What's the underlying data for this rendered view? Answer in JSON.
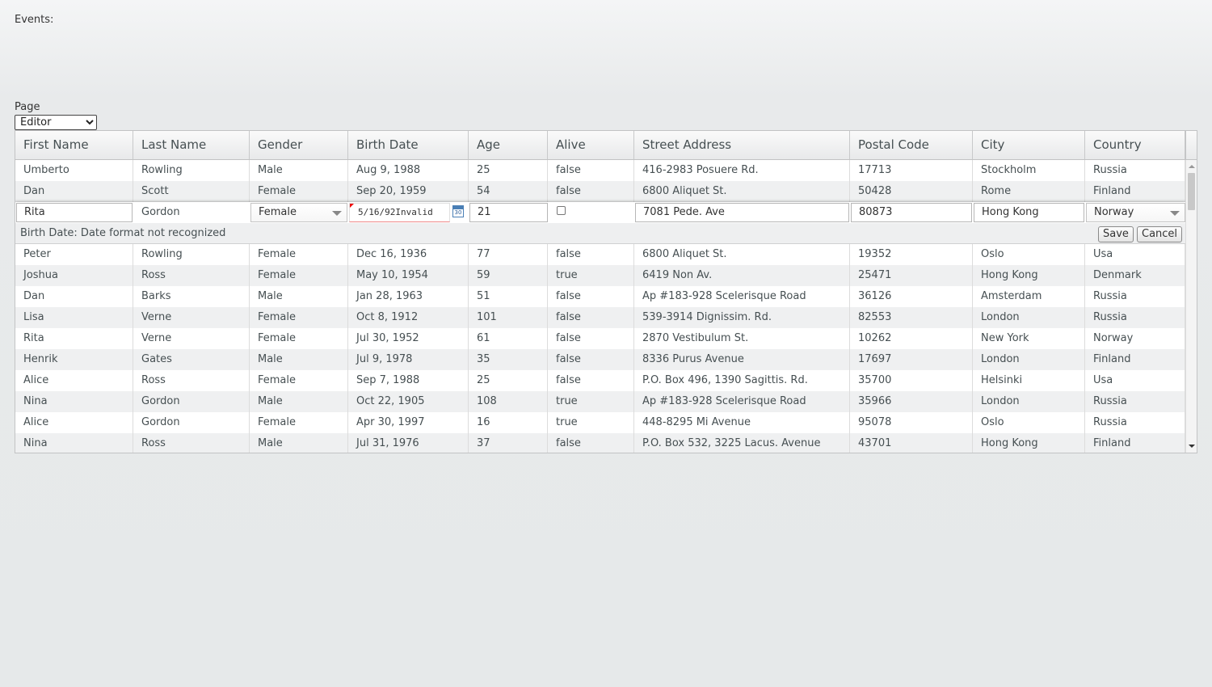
{
  "events": {
    "label": "Events:"
  },
  "page_selector": {
    "label": "Page",
    "selected": "Editor",
    "options": [
      "Editor"
    ]
  },
  "grid": {
    "columns": [
      "First Name",
      "Last Name",
      "Gender",
      "Birth Date",
      "Age",
      "Alive",
      "Street Address",
      "Postal Code",
      "City",
      "Country"
    ],
    "rows_before": [
      [
        "Umberto",
        "Rowling",
        "Male",
        "Aug 9, 1988",
        "25",
        "false",
        "416-2983 Posuere Rd.",
        "17713",
        "Stockholm",
        "Russia"
      ],
      [
        "Dan",
        "Scott",
        "Female",
        "Sep 20, 1959",
        "54",
        "false",
        "6800 Aliquet St.",
        "50428",
        "Rome",
        "Finland"
      ]
    ],
    "editor": {
      "first_name": "Rita",
      "last_name": "Gordon",
      "gender": "Female",
      "birth_date": "5/16/92Invalid",
      "calendar_icon": "calendar-icon",
      "calendar_number": "30",
      "age": "21",
      "alive_checked": false,
      "street_address": "7081 Pede. Ave",
      "postal_code": "80873",
      "city": "Hong Kong",
      "country": "Norway",
      "error_message": "Birth Date: Date format not recognized",
      "save_label": "Save",
      "cancel_label": "Cancel"
    },
    "rows_after": [
      [
        "Peter",
        "Rowling",
        "Female",
        "Dec 16, 1936",
        "77",
        "false",
        "6800 Aliquet St.",
        "19352",
        "Oslo",
        "Usa"
      ],
      [
        "Joshua",
        "Ross",
        "Female",
        "May 10, 1954",
        "59",
        "true",
        "6419 Non Av.",
        "25471",
        "Hong Kong",
        "Denmark"
      ],
      [
        "Dan",
        "Barks",
        "Male",
        "Jan 28, 1963",
        "51",
        "false",
        "Ap #183-928 Scelerisque Road",
        "36126",
        "Amsterdam",
        "Russia"
      ],
      [
        "Lisa",
        "Verne",
        "Female",
        "Oct 8, 1912",
        "101",
        "false",
        "539-3914 Dignissim. Rd.",
        "82553",
        "London",
        "Russia"
      ],
      [
        "Rita",
        "Verne",
        "Female",
        "Jul 30, 1952",
        "61",
        "false",
        "2870 Vestibulum St.",
        "10262",
        "New York",
        "Norway"
      ],
      [
        "Henrik",
        "Gates",
        "Male",
        "Jul 9, 1978",
        "35",
        "false",
        "8336 Purus Avenue",
        "17697",
        "London",
        "Finland"
      ],
      [
        "Alice",
        "Ross",
        "Female",
        "Sep 7, 1988",
        "25",
        "false",
        "P.O. Box 496, 1390 Sagittis. Rd.",
        "35700",
        "Helsinki",
        "Usa"
      ],
      [
        "Nina",
        "Gordon",
        "Male",
        "Oct 22, 1905",
        "108",
        "true",
        "Ap #183-928 Scelerisque Road",
        "35966",
        "London",
        "Russia"
      ],
      [
        "Alice",
        "Gordon",
        "Female",
        "Apr 30, 1997",
        "16",
        "true",
        "448-8295 Mi Avenue",
        "95078",
        "Oslo",
        "Russia"
      ],
      [
        "Nina",
        "Ross",
        "Male",
        "Jul 31, 1976",
        "37",
        "false",
        "P.O. Box 532, 3225 Lacus. Avenue",
        "43701",
        "Hong Kong",
        "Finland"
      ]
    ]
  }
}
